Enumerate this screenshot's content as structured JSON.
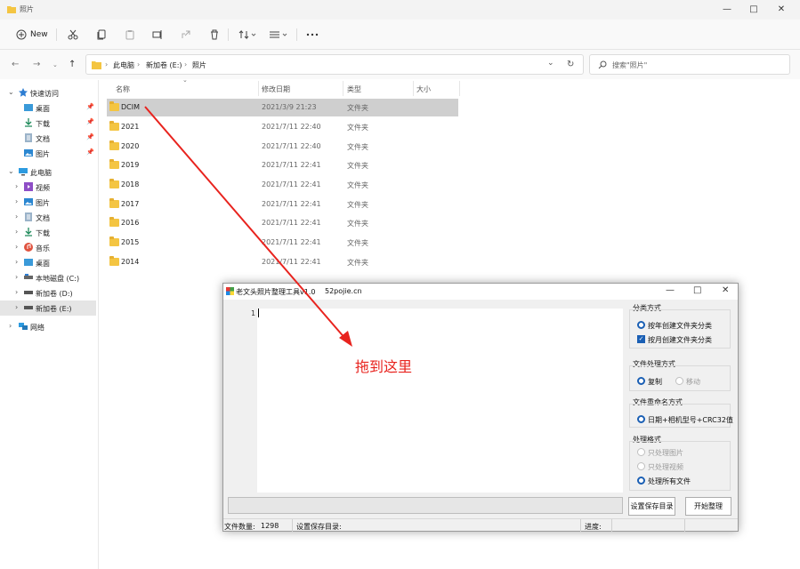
{
  "explorer": {
    "window_title": "照片",
    "toolbar": {
      "new_label": "New",
      "actions": [
        "cut-icon",
        "copy-icon",
        "paste-icon",
        "rename-icon",
        "share-icon",
        "delete-icon",
        "sort-icon",
        "view-icon",
        "more-icon"
      ]
    },
    "address": {
      "crumbs": [
        "此电脑",
        "新加卷 (E:)",
        "照片"
      ],
      "search_placeholder": "搜索\"照片\""
    },
    "sidebar": {
      "quick_access": "快速访问",
      "quick_items": [
        "桌面",
        "下载",
        "文档",
        "图片"
      ],
      "this_pc": "此电脑",
      "pc_items": [
        "视频",
        "图片",
        "文档",
        "下载",
        "音乐",
        "桌面",
        "本地磁盘 (C:)",
        "新加卷 (D:)",
        "新加卷 (E:)"
      ],
      "network": "网络"
    },
    "columns": [
      "名称",
      "修改日期",
      "类型",
      "大小"
    ],
    "files": [
      {
        "name": "DCIM",
        "date": "2021/3/9 21:23",
        "type": "文件夹"
      },
      {
        "name": "2021",
        "date": "2021/7/11 22:40",
        "type": "文件夹"
      },
      {
        "name": "2020",
        "date": "2021/7/11 22:40",
        "type": "文件夹"
      },
      {
        "name": "2019",
        "date": "2021/7/11 22:41",
        "type": "文件夹"
      },
      {
        "name": "2018",
        "date": "2021/7/11 22:41",
        "type": "文件夹"
      },
      {
        "name": "2017",
        "date": "2021/7/11 22:41",
        "type": "文件夹"
      },
      {
        "name": "2016",
        "date": "2021/7/11 22:41",
        "type": "文件夹"
      },
      {
        "name": "2015",
        "date": "2021/7/11 22:41",
        "type": "文件夹"
      },
      {
        "name": "2014",
        "date": "2021/7/11 22:41",
        "type": "文件夹"
      }
    ]
  },
  "tool": {
    "title": "老文头照片整理工具v1.0",
    "site": "52pojie.cn",
    "editor_line": "1",
    "group1": {
      "label": "分类方式",
      "opt1": "按年创建文件夹分类",
      "opt2": "按月创建文件夹分类"
    },
    "group2": {
      "label": "文件处理方式",
      "opt1": "复制",
      "opt2": "移动"
    },
    "group3": {
      "label": "文件重命名方式",
      "opt1": "日期+相机型号+CRC32值"
    },
    "group4": {
      "label": "处理格式",
      "opt1": "只处理图片",
      "opt2": "只处理视频",
      "opt3": "处理所有文件"
    },
    "btn_save_dir": "设置保存目录",
    "btn_start": "开始整理",
    "status": {
      "count_label": "文件数量:",
      "count_value": "1298",
      "dir_label": "设置保存目录:",
      "progress_label": "进度:"
    }
  },
  "annotation": {
    "text": "拖到这里",
    "color": "#e8231e"
  }
}
